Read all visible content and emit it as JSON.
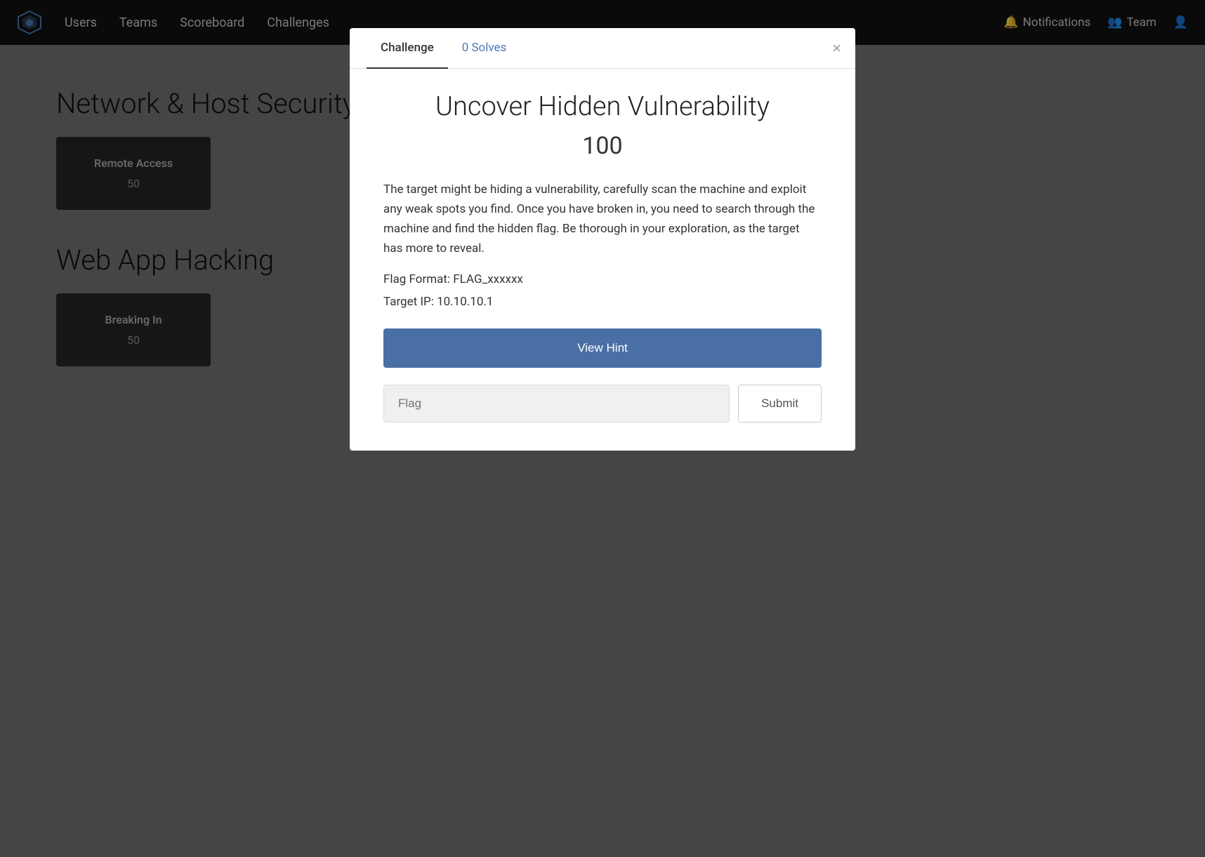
{
  "navbar": {
    "brand_logo_alt": "CyberForge",
    "links": [
      {
        "label": "Users",
        "id": "users"
      },
      {
        "label": "Teams",
        "id": "teams"
      },
      {
        "label": "Scoreboard",
        "id": "scoreboard"
      },
      {
        "label": "Challenges",
        "id": "challenges"
      }
    ],
    "right": [
      {
        "label": "Notifications",
        "id": "notifications",
        "icon": "🔔"
      },
      {
        "label": "Team",
        "id": "team",
        "icon": "👥"
      },
      {
        "label": "profile",
        "id": "profile",
        "icon": "👤"
      }
    ]
  },
  "background": {
    "sections": [
      {
        "id": "network-host-security",
        "title": "Network & Host Security",
        "cards": [
          {
            "title": "Remote Access",
            "points": "50"
          }
        ]
      },
      {
        "id": "web-app-hacking",
        "title": "Web App Hacking",
        "cards": [
          {
            "title": "Breaking In",
            "points": "50"
          }
        ]
      }
    ]
  },
  "modal": {
    "tab_challenge": "Challenge",
    "tab_solves": "0 Solves",
    "close_label": "×",
    "title": "Uncover Hidden Vulnerability",
    "points": "100",
    "description": "The target might be hiding a vulnerability, carefully scan the machine and exploit any weak spots you find. Once you have broken in, you need to search through the machine and find the hidden flag. Be thorough in your exploration, as the target has more to reveal.",
    "flag_format": "Flag Format: FLAG_xxxxxx",
    "target_ip": "Target IP: 10.10.10.1",
    "view_hint_label": "View Hint",
    "flag_placeholder": "Flag",
    "submit_label": "Submit"
  }
}
